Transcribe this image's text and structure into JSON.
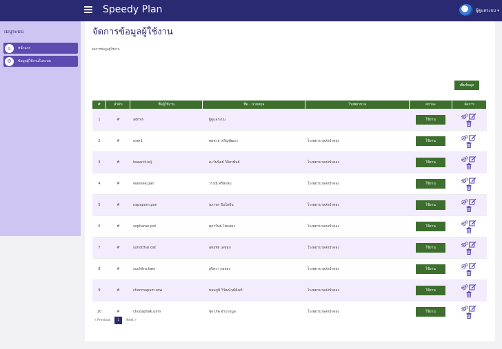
{
  "app": {
    "title": "Speedy Plan",
    "user_name": "ผู้ดูแลระบบ ▾"
  },
  "sidebar": {
    "heading": "เมนูระบบ",
    "items": [
      {
        "label": "หน้าแรก",
        "icon": "home-icon"
      },
      {
        "label": "ข้อมูลผู้ใช้งานในระบบ",
        "icon": "gears-icon"
      }
    ]
  },
  "page": {
    "title": "จัดการข้อมูลผู้ใช้งาน",
    "breadcrumb": "จัดการข้อมูลผู้ใช้งาน",
    "add_label": "เพิ่มข้อมูล"
  },
  "table": {
    "headers": [
      "#",
      "ลำดับ",
      "ชื่อผู้ใช้งาน",
      "ชื่อ - นามสกุล",
      "โรงพยาบาล",
      "สถานะ",
      "จัดการ"
    ],
    "rows": [
      {
        "num": "1",
        "order": "#",
        "username": "admin",
        "fullname": "ผู้ดูแลระบบ",
        "hospital": "",
        "status": "ใช้งาน"
      },
      {
        "num": "2",
        "order": "#",
        "username": "user1",
        "fullname": "สมชาย เจริญพัฒนา",
        "hospital": "โรงพยาบาลส่งป่าตอง",
        "status": "ใช้งาน"
      },
      {
        "num": "3",
        "order": "#",
        "username": "tawanit.wij",
        "fullname": "ตะวันนิตย์ วิจิตรพันธ์",
        "hospital": "โรงพยาบาลส่งป่าตอง",
        "status": "ใช้งาน"
      },
      {
        "num": "4",
        "order": "#",
        "username": "wannee.pan",
        "fullname": "วรรณี ศรีพรหม",
        "hospital": "โรงพยาบาลส่งป่าตอง",
        "status": "ใช้งาน"
      },
      {
        "num": "5",
        "order": "#",
        "username": "napaporn.pan",
        "fullname": "นภาพร ปิ่นใสปั่น",
        "hospital": "โรงพยาบาลส่งป่าตอง",
        "status": "ใช้งาน"
      },
      {
        "num": "6",
        "order": "#",
        "username": "supharan.pot",
        "fullname": "ศุภารันต์ โพธสมร",
        "hospital": "โรงพยาบาลส่งป่าตอง",
        "status": "ใช้งาน"
      },
      {
        "num": "7",
        "order": "#",
        "username": "suhotthai.dat",
        "fullname": "สุหฤทัย เดชสุภ",
        "hospital": "โรงพยาบาลส่งป่าตอง",
        "status": "ใช้งาน"
      },
      {
        "num": "8",
        "order": "#",
        "username": "suchitra.kam",
        "fullname": "สุจิตรา กมลธง",
        "hospital": "โรงพยาบาลส่งป่าตอง",
        "status": "ใช้งาน"
      },
      {
        "num": "9",
        "order": "#",
        "username": "chonmapum.wiw",
        "fullname": "ชลมภูมิ วิวัฒน์วุฒิอินท์",
        "hospital": "โรงพยาบาลส่งป่าตอง",
        "status": "ใช้งาน"
      },
      {
        "num": "10",
        "order": "#",
        "username": "chudaphak.umn",
        "fullname": "ชุดาภัค อำนาจมูล",
        "hospital": "โรงพยาบาลส่งป่าตอง",
        "status": "ใช้งาน"
      }
    ]
  },
  "pagination": {
    "previous": "« Previous",
    "current": "1",
    "next": "Next »"
  },
  "colors": {
    "navbar": "#2a2a72",
    "sidebar": "#cfc5f2",
    "sidebar_item": "#5d4bb0",
    "accent_green": "#3d6e2e",
    "row_alt": "#f3ecfc"
  }
}
